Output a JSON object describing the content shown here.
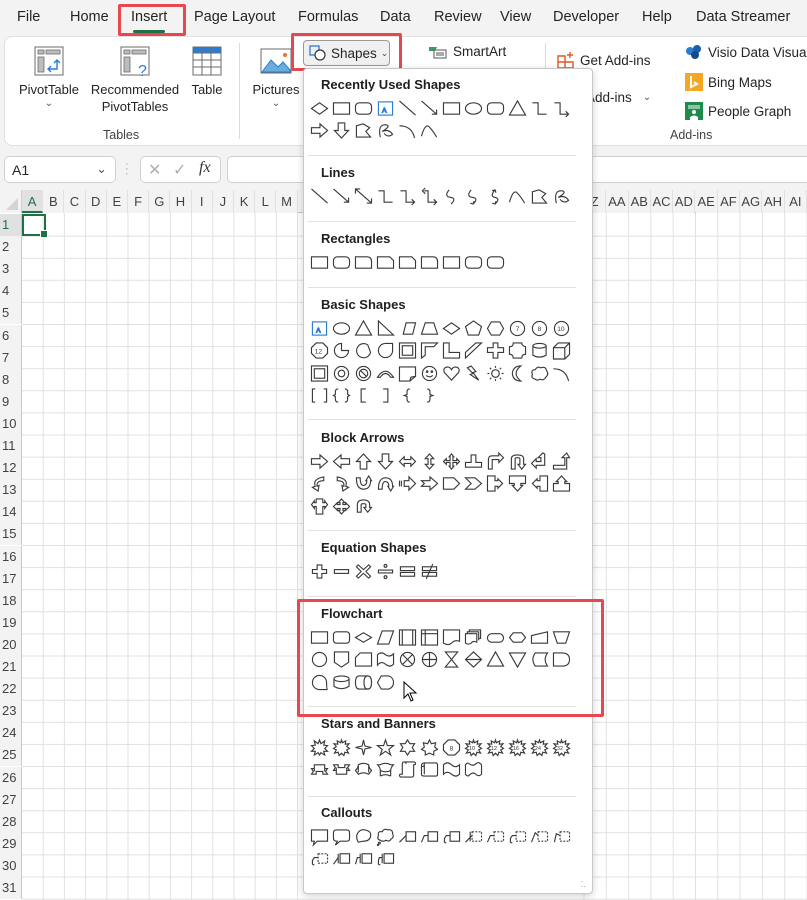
{
  "menu": {
    "tabs": [
      {
        "label": "File",
        "active": false
      },
      {
        "label": "Home",
        "active": false
      },
      {
        "label": "Insert",
        "active": true
      },
      {
        "label": "Page Layout",
        "active": false
      },
      {
        "label": "Formulas",
        "active": false
      },
      {
        "label": "Data",
        "active": false
      },
      {
        "label": "Review",
        "active": false
      },
      {
        "label": "View",
        "active": false
      },
      {
        "label": "Developer",
        "active": false
      },
      {
        "label": "Help",
        "active": false
      },
      {
        "label": "Data Streamer",
        "active": false
      }
    ]
  },
  "ribbon": {
    "tables_group": {
      "label": "Tables",
      "pivottable": "PivotTable",
      "recommended_line1": "Recommended",
      "recommended_line2": "PivotTables",
      "table": "Table"
    },
    "illustrations": {
      "pictures": "Pictures",
      "shapes": "Shapes",
      "smartart": "SmartArt"
    },
    "addins_group": {
      "label": "Add-ins",
      "get_addins": "Get Add-ins",
      "my_addins": "My Add-ins",
      "visio": "Visio Data Visualizer",
      "bing_maps": "Bing Maps",
      "people_graph": "People Graph"
    }
  },
  "formula_bar": {
    "name_box": "A1",
    "cancel_icon": "✕",
    "enter_icon": "✓",
    "fx_label": "fx",
    "formula_value": ""
  },
  "grid": {
    "columns_left": [
      "A",
      "B",
      "C",
      "D",
      "E",
      "F",
      "G",
      "H",
      "I",
      "J",
      "K",
      "L",
      "M"
    ],
    "columns_right": [
      "Z",
      "AA",
      "AB",
      "AC",
      "AD",
      "AE",
      "AF",
      "AG",
      "AH",
      "AI"
    ],
    "rows": [
      "1",
      "2",
      "3",
      "4",
      "5",
      "6",
      "7",
      "8",
      "9",
      "10",
      "11",
      "12",
      "13",
      "14",
      "15",
      "16",
      "17",
      "18",
      "19",
      "20",
      "21",
      "22",
      "23",
      "24",
      "25",
      "26",
      "27",
      "28",
      "29",
      "30",
      "31"
    ],
    "active_cell": "A1"
  },
  "shapes_panel": {
    "sections": [
      {
        "title": "Recently Used Shapes",
        "count": 20
      },
      {
        "title": "Lines",
        "count": 12
      },
      {
        "title": "Rectangles",
        "count": 9
      },
      {
        "title": "Basic Shapes",
        "count": 42
      },
      {
        "title": "Block Arrows",
        "count": 27
      },
      {
        "title": "Equation Shapes",
        "count": 6
      },
      {
        "title": "Flowchart",
        "count": 28
      },
      {
        "title": "Stars and Banners",
        "count": 20
      },
      {
        "title": "Callouts",
        "count": 16
      }
    ],
    "highlighted_section": "Flowchart"
  },
  "highlight_color": "#e8474f",
  "accent_color": "#1e7145"
}
